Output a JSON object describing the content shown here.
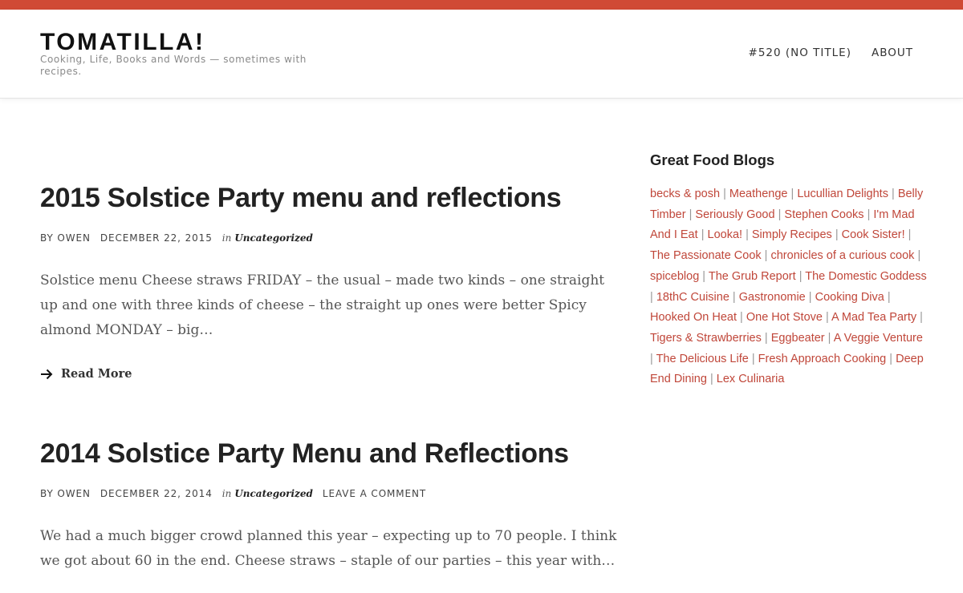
{
  "header": {
    "title": "TOMATILLA!",
    "tagline": "Cooking, Life, Books and Words — sometimes with recipes.",
    "nav": [
      {
        "label": "#520 (NO TITLE)"
      },
      {
        "label": "ABOUT"
      }
    ]
  },
  "colors": {
    "accent_strip": "#d04a35",
    "link": "#c0473a"
  },
  "posts": [
    {
      "title": "2015 Solstice Party menu and reflections",
      "by": "BY OWEN",
      "date": "DECEMBER 22, 2015",
      "in": "in",
      "category": "Uncategorized",
      "excerpt": "Solstice menu Cheese straws FRIDAY – the usual – made two kinds – one straight up and one with three kinds of cheese – the straight up ones were better Spicy almond MONDAY – big…",
      "read_more": "Read More",
      "read_more_icon": "arrow-right-icon"
    },
    {
      "title": "2014 Solstice Party Menu and Reflections",
      "by": "BY OWEN",
      "date": "DECEMBER 22, 2014",
      "in": "in",
      "category": "Uncategorized",
      "comment": "LEAVE A COMMENT",
      "excerpt": "We had a much bigger crowd planned this year – expecting up to 70 people. I think we got about 60 in the end. Cheese straws – staple of our parties – this year with…"
    }
  ],
  "sidebar": {
    "widget_title": "Great Food Blogs",
    "separator": "|",
    "blogs": [
      "becks & posh",
      "Meathenge",
      "Lucullian Delights",
      "Belly Timber",
      "Seriously Good",
      "Stephen Cooks",
      "I'm Mad And I Eat",
      "Looka!",
      "Simply Recipes",
      "Cook Sister!",
      "The Passionate Cook",
      "chronicles of a curious cook",
      "spiceblog",
      "The Grub Report",
      "The Domestic Goddess",
      "18thC Cuisine",
      "Gastronomie",
      "Cooking Diva",
      "Hooked On Heat",
      "One Hot Stove",
      "A Mad Tea Party",
      "Tigers & Strawberries",
      "Eggbeater",
      "A Veggie Venture",
      "The Delicious Life",
      "Fresh Approach Cooking",
      "Deep End Dining",
      "Lex Culinaria"
    ]
  }
}
